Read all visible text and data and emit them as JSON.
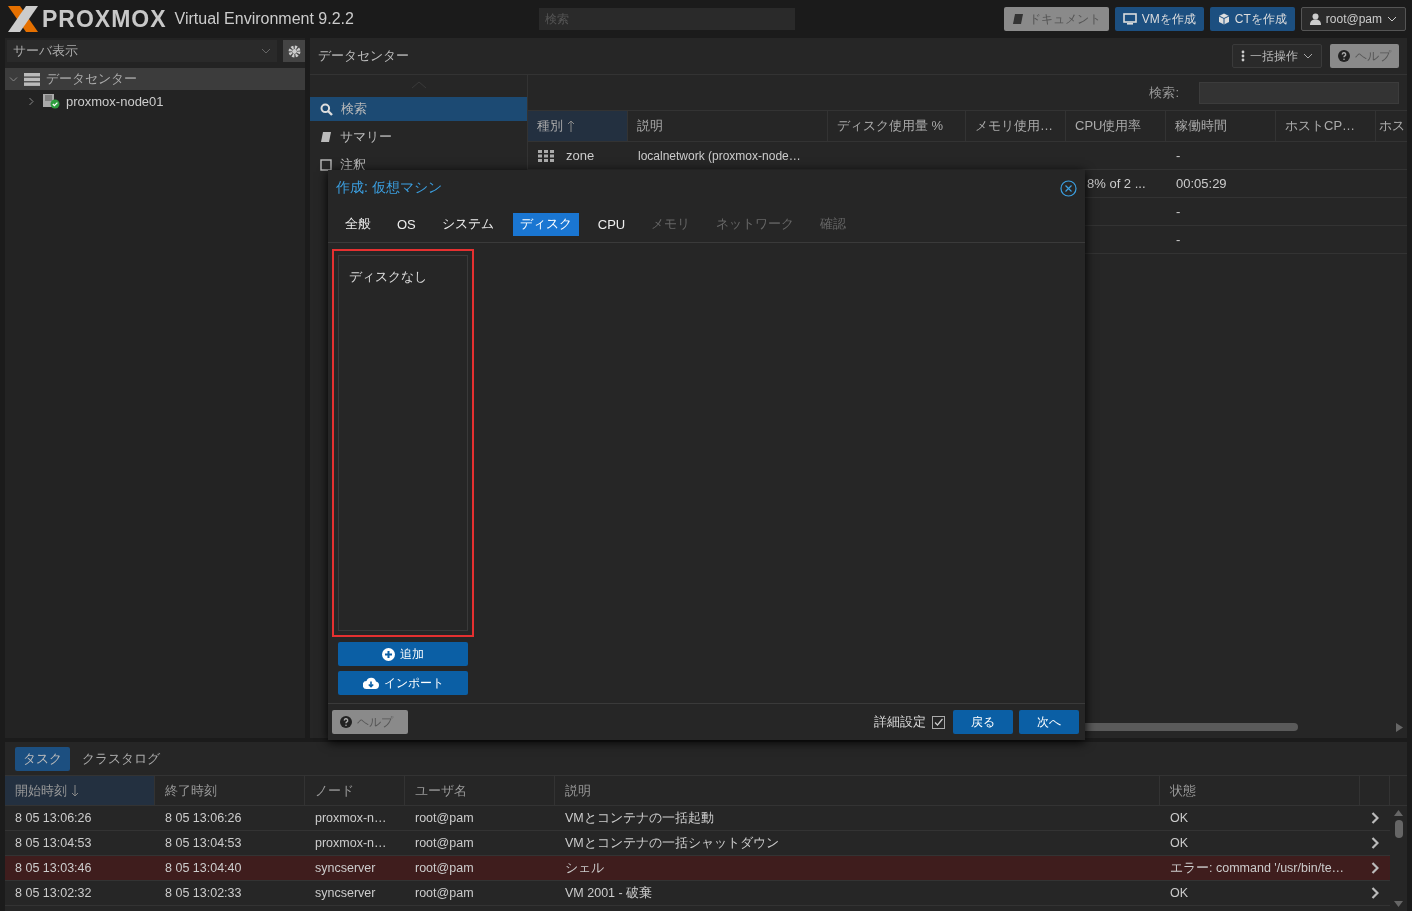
{
  "header": {
    "logo": "PROXMOX",
    "product": "Virtual Environment 9.2.2",
    "search": {
      "placeholder": "検索"
    },
    "buttons": [
      {
        "label": "ドキュメント",
        "kind": "docs"
      },
      {
        "label": "VMを作成",
        "kind": "vm"
      },
      {
        "label": "CTを作成",
        "kind": "ct"
      }
    ],
    "user": "root@pam"
  },
  "sidebar": {
    "view": "サーバ表示",
    "tree": [
      {
        "label": "データセンター",
        "selected": true,
        "expanded": true,
        "children": [
          {
            "label": "proxmox-node01",
            "selected": false,
            "expanded": false
          }
        ]
      }
    ]
  },
  "content": {
    "title": "データセンター",
    "toolbar": [
      {
        "label": "一括操作",
        "kind": "menu"
      },
      {
        "label": "ヘルプ",
        "kind": "help"
      }
    ],
    "nav": [
      {
        "label": "検索",
        "selected": true
      },
      {
        "label": "サマリー",
        "selected": false
      },
      {
        "label": "注釈",
        "selected": false
      }
    ],
    "grid": {
      "search_label": "検索:",
      "columns": [
        {
          "label": "種別",
          "sorted": true,
          "ascending": true
        },
        {
          "label": "説明",
          "sorted": false
        },
        {
          "label": "ディスク使用量 %",
          "sorted": false
        },
        {
          "label": "メモリ使用…",
          "sorted": false
        },
        {
          "label": "CPU使用率",
          "sorted": false
        },
        {
          "label": "稼働時間",
          "sorted": false
        },
        {
          "label": "ホストCP…",
          "sorted": false
        },
        {
          "label": "ホス",
          "sorted": false
        }
      ],
      "rows": [
        {
          "type": "zone",
          "description": "localnetwork (proxmox-node…",
          "uptime": "-"
        },
        {
          "cpu": "8% of 2 ...",
          "uptime": "00:05:29"
        },
        {
          "uptime": "-"
        },
        {
          "uptime": "-"
        }
      ]
    }
  },
  "dialog": {
    "title": "作成: 仮想マシン",
    "tabs": [
      {
        "label": "全般",
        "selected": false,
        "disabled": false
      },
      {
        "label": "OS",
        "selected": false,
        "disabled": false
      },
      {
        "label": "システム",
        "selected": false,
        "disabled": false
      },
      {
        "label": "ディスク",
        "selected": true,
        "disabled": false
      },
      {
        "label": "CPU",
        "selected": false,
        "disabled": false
      },
      {
        "label": "メモリ",
        "selected": false,
        "disabled": true
      },
      {
        "label": "ネットワーク",
        "selected": false,
        "disabled": true
      },
      {
        "label": "確認",
        "selected": false,
        "disabled": true
      }
    ],
    "disk_list": {
      "empty_text": "ディスクなし",
      "highlighted": true
    },
    "buttons": [
      {
        "label": "追加",
        "kind": "add"
      },
      {
        "label": "インポート",
        "kind": "import"
      }
    ],
    "footer": {
      "help": "ヘルプ",
      "advanced": {
        "label": "詳細設定",
        "checked": true
      },
      "back": "戻る",
      "next": "次へ"
    }
  },
  "tasks": {
    "tabs": [
      {
        "label": "タスク",
        "selected": true
      },
      {
        "label": "クラスタログ",
        "selected": false
      }
    ],
    "columns": [
      {
        "label": "開始時刻",
        "sorted": true,
        "ascending": false
      },
      {
        "label": "終了時刻",
        "sorted": false
      },
      {
        "label": "ノード",
        "sorted": false
      },
      {
        "label": "ユーザ名",
        "sorted": false
      },
      {
        "label": "説明",
        "sorted": false
      },
      {
        "label": "状態",
        "sorted": false
      }
    ],
    "rows": [
      {
        "start": "8 05 13:06:26",
        "end": "8 05 13:06:26",
        "node": "proxmox-n…",
        "user": "root@pam",
        "description": "VMとコンテナの一括起動",
        "status": "OK",
        "error": false
      },
      {
        "start": "8 05 13:04:53",
        "end": "8 05 13:04:53",
        "node": "proxmox-n…",
        "user": "root@pam",
        "description": "VMとコンテナの一括シャットダウン",
        "status": "OK",
        "error": false
      },
      {
        "start": "8 05 13:03:46",
        "end": "8 05 13:04:40",
        "node": "syncserver",
        "user": "root@pam",
        "description": "シェル",
        "status": "エラー: command '/usr/bin/te…",
        "error": true
      },
      {
        "start": "8 05 13:02:32",
        "end": "8 05 13:02:33",
        "node": "syncserver",
        "user": "root@pam",
        "description": "VM 2001 - 破棄",
        "status": "OK",
        "error": false
      }
    ]
  }
}
